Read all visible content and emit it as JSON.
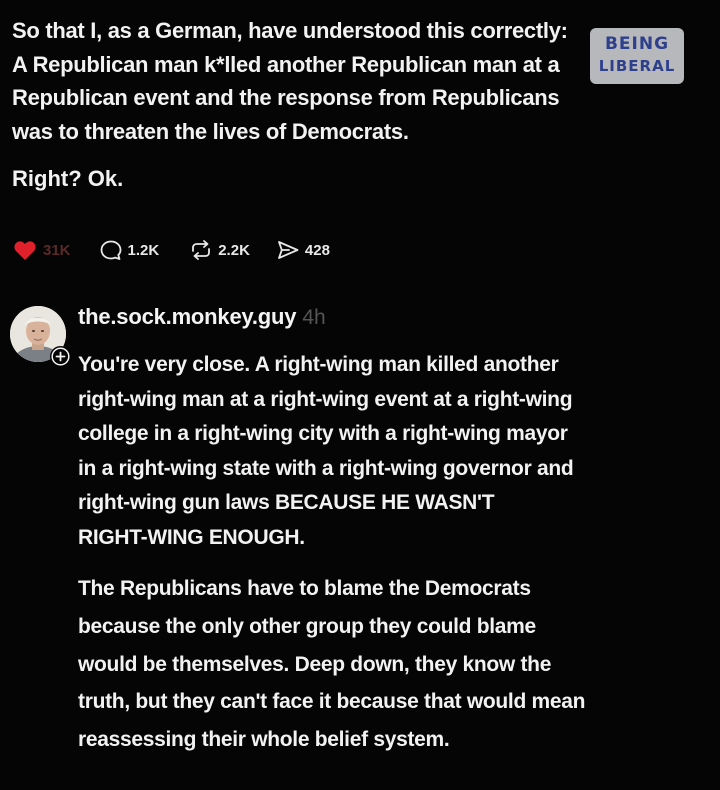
{
  "post": {
    "lines": [
      "So that I, as a German, have understood this correctly:",
      "A Republican man k*lled another Republican man at a",
      "Republican event and the response from Republicans",
      "was to threaten the lives of Democrats."
    ],
    "follow_up": "Right? Ok."
  },
  "actions": {
    "likes": "31K",
    "comments": "1.2K",
    "reposts": "2.2K",
    "shares": "428",
    "like_color": "#e0212b",
    "icons": [
      "heart-icon",
      "comment-icon",
      "repost-icon",
      "send-icon"
    ]
  },
  "watermark": {
    "line1": "BEING",
    "line2": "LIBERAL"
  },
  "reply": {
    "username": "the.sock.monkey.guy",
    "time": "4h",
    "paragraph1": [
      "You're very close. A right-wing man killed another",
      "right-wing man at a right-wing event at a right-wing",
      "college in a right-wing city with a right-wing mayor",
      "in a right-wing state with a right-wing governor and",
      "right-wing gun laws BECAUSE HE WASN'T",
      "RIGHT-WING ENOUGH."
    ],
    "paragraph2": [
      "The Republicans have to blame the Democrats",
      "because the only other group they could blame",
      "would be themselves. Deep down, they know the",
      "truth, but they can't face it because that would mean",
      "reassessing their whole belief system."
    ]
  },
  "colors": {
    "background": "#050505",
    "text": "#f2f2f2",
    "timestamp": "#555555",
    "watermark_text": "#2e3f8c"
  }
}
